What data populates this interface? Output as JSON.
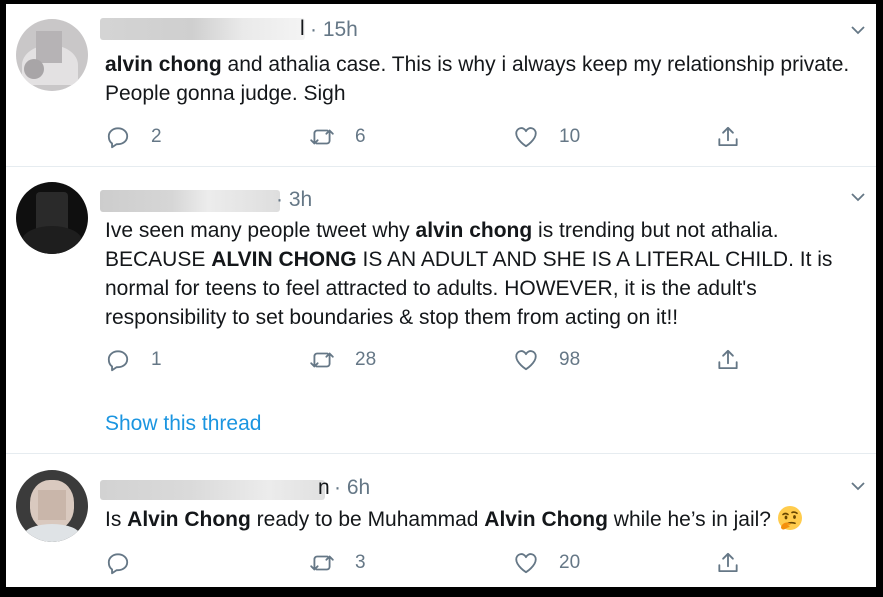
{
  "tweets": [
    {
      "time": "· 15h",
      "name_fragment": "l",
      "text_parts": [
        {
          "t": "alvin chong",
          "b": true
        },
        {
          "t": " and athalia case. This is why i always keep my relationship private. People gonna judge. Sigh",
          "b": false
        }
      ],
      "replies": "2",
      "retweets": "6",
      "likes": "10"
    },
    {
      "time": "· 3h",
      "text_parts": [
        {
          "t": "Ive seen many people tweet why ",
          "b": false
        },
        {
          "t": "alvin chong",
          "b": true
        },
        {
          "t": " is trending but not athalia. BECAUSE ",
          "b": false
        },
        {
          "t": "ALVIN CHONG",
          "b": true
        },
        {
          "t": " IS AN ADULT AND SHE IS A LITERAL CHILD. It is normal for teens to feel attracted to adults. HOWEVER, it is the adult's responsibility to set boundaries & stop them from acting on it!!",
          "b": false
        }
      ],
      "replies": "1",
      "retweets": "28",
      "likes": "98",
      "show_thread": "Show this thread"
    },
    {
      "time": "· 6h",
      "name_fragment": "n",
      "text_parts": [
        {
          "t": "Is ",
          "b": false
        },
        {
          "t": "Alvin Chong",
          "b": true
        },
        {
          "t": " ready to be Muhammad ",
          "b": false
        },
        {
          "t": "Alvin Chong",
          "b": true
        },
        {
          "t": " while he’s in jail?",
          "b": false
        }
      ],
      "emoji": "thinking-face-emoji",
      "replies": "",
      "retweets": "3",
      "likes": "20"
    }
  ],
  "colors": {
    "link": "#1b95e0",
    "meta": "#657786",
    "text": "#14171a",
    "divider": "#e6ecf0"
  }
}
